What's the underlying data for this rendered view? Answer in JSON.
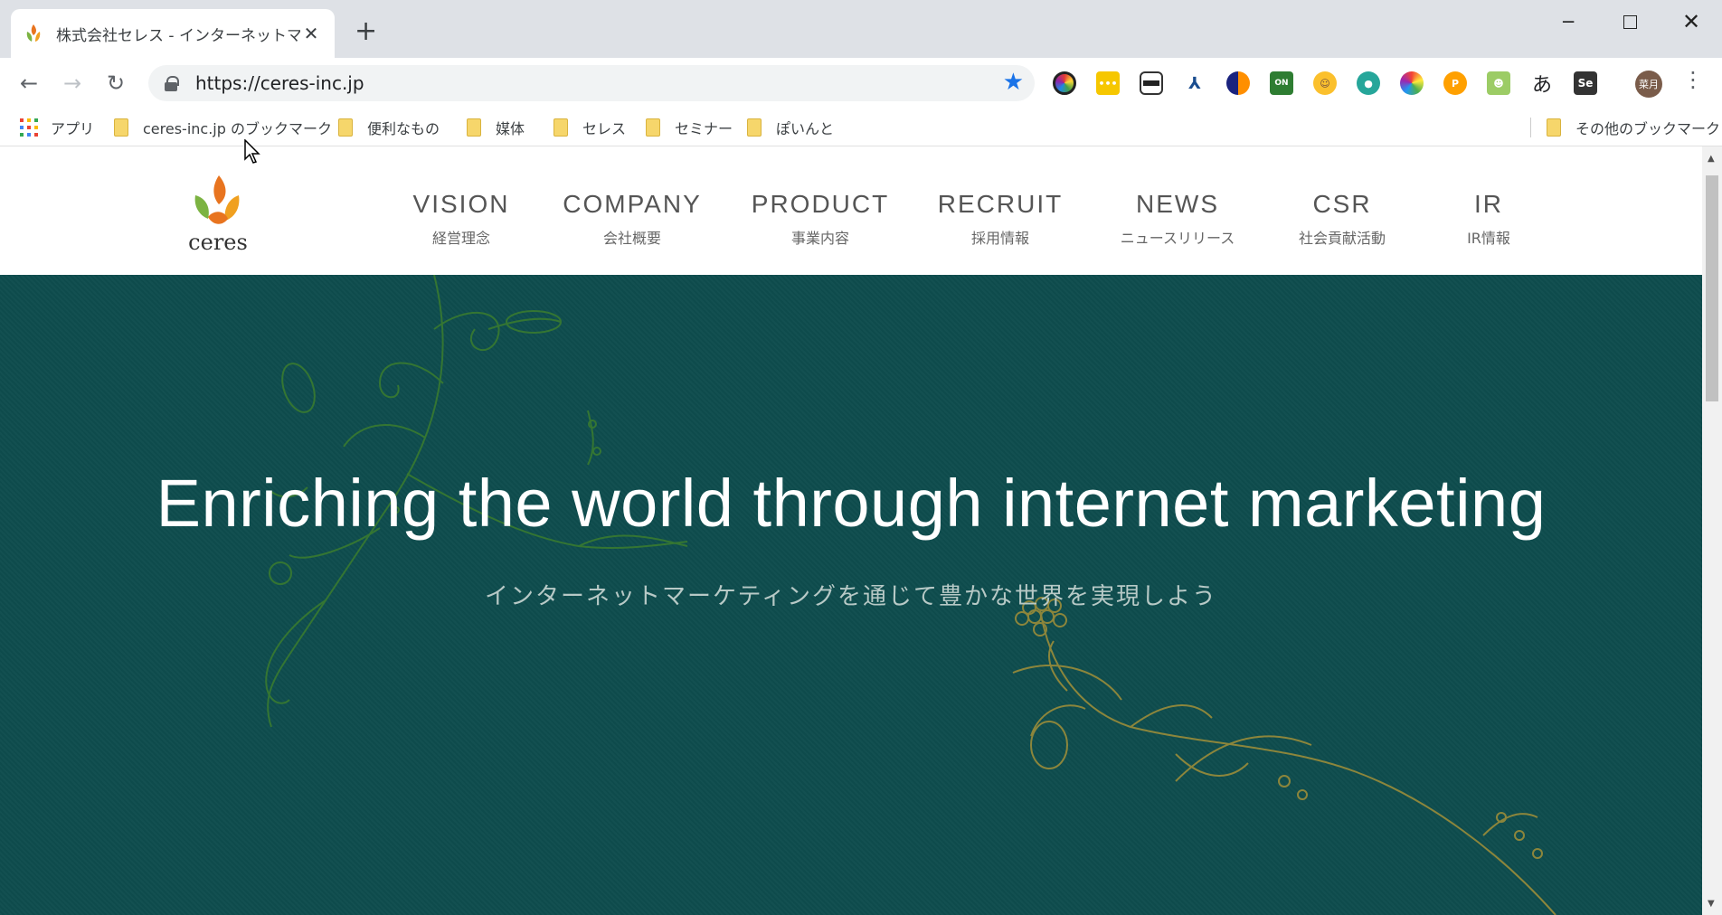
{
  "browser": {
    "tab_title": "株式会社セレス - インターネットマーケ",
    "tab_close": "✕",
    "new_tab": "+",
    "url": "https://ceres-inc.jp",
    "window_controls": {
      "minimize": "─",
      "close": "✕"
    },
    "nav": {
      "back": "←",
      "forward": "→",
      "reload": "↻"
    },
    "star": "★",
    "menu": "⋮",
    "profile_label": "菜月",
    "ext_text_a": "あ",
    "ext_text_se": "Se",
    "extensions": [
      "color-picker-icon",
      "memo-icon",
      "incognito-mask-icon",
      "link-icon",
      "dark-reader-icon",
      "on-toggle-icon",
      "smile-icon",
      "gecko-icon",
      "color-wheel-icon",
      "p-icon",
      "frog-icon",
      "hiragana-a-icon",
      "selenium-icon"
    ]
  },
  "bookmarks": {
    "apps": "アプリ",
    "items": [
      "ceres-inc.jp のブックマーク",
      "便利なもの",
      "媒体",
      "セレス",
      "セミナー",
      "ぽいんと"
    ],
    "other": "その他のブックマーク"
  },
  "site": {
    "logo_text": "ceres",
    "nav": [
      {
        "en": "VISION",
        "ja": "経営理念"
      },
      {
        "en": "COMPANY",
        "ja": "会社概要"
      },
      {
        "en": "PRODUCT",
        "ja": "事業内容"
      },
      {
        "en": "RECRUIT",
        "ja": "採用情報"
      },
      {
        "en": "NEWS",
        "ja": "ニュースリリース"
      },
      {
        "en": "CSR",
        "ja": "社会貢献活動"
      },
      {
        "en": "IR",
        "ja": "IR情報"
      }
    ],
    "hero": {
      "title": "Enriching the world through internet marketing",
      "subtitle": "インターネットマーケティングを通じて豊かな世界を実現しよう"
    }
  },
  "colors": {
    "hero_bg": "#0e4d4e",
    "vine_green": "#3b7d2e",
    "vine_gold": "#9a8c3a",
    "logo_orange": "#e8741f",
    "logo_green": "#7cb342"
  }
}
